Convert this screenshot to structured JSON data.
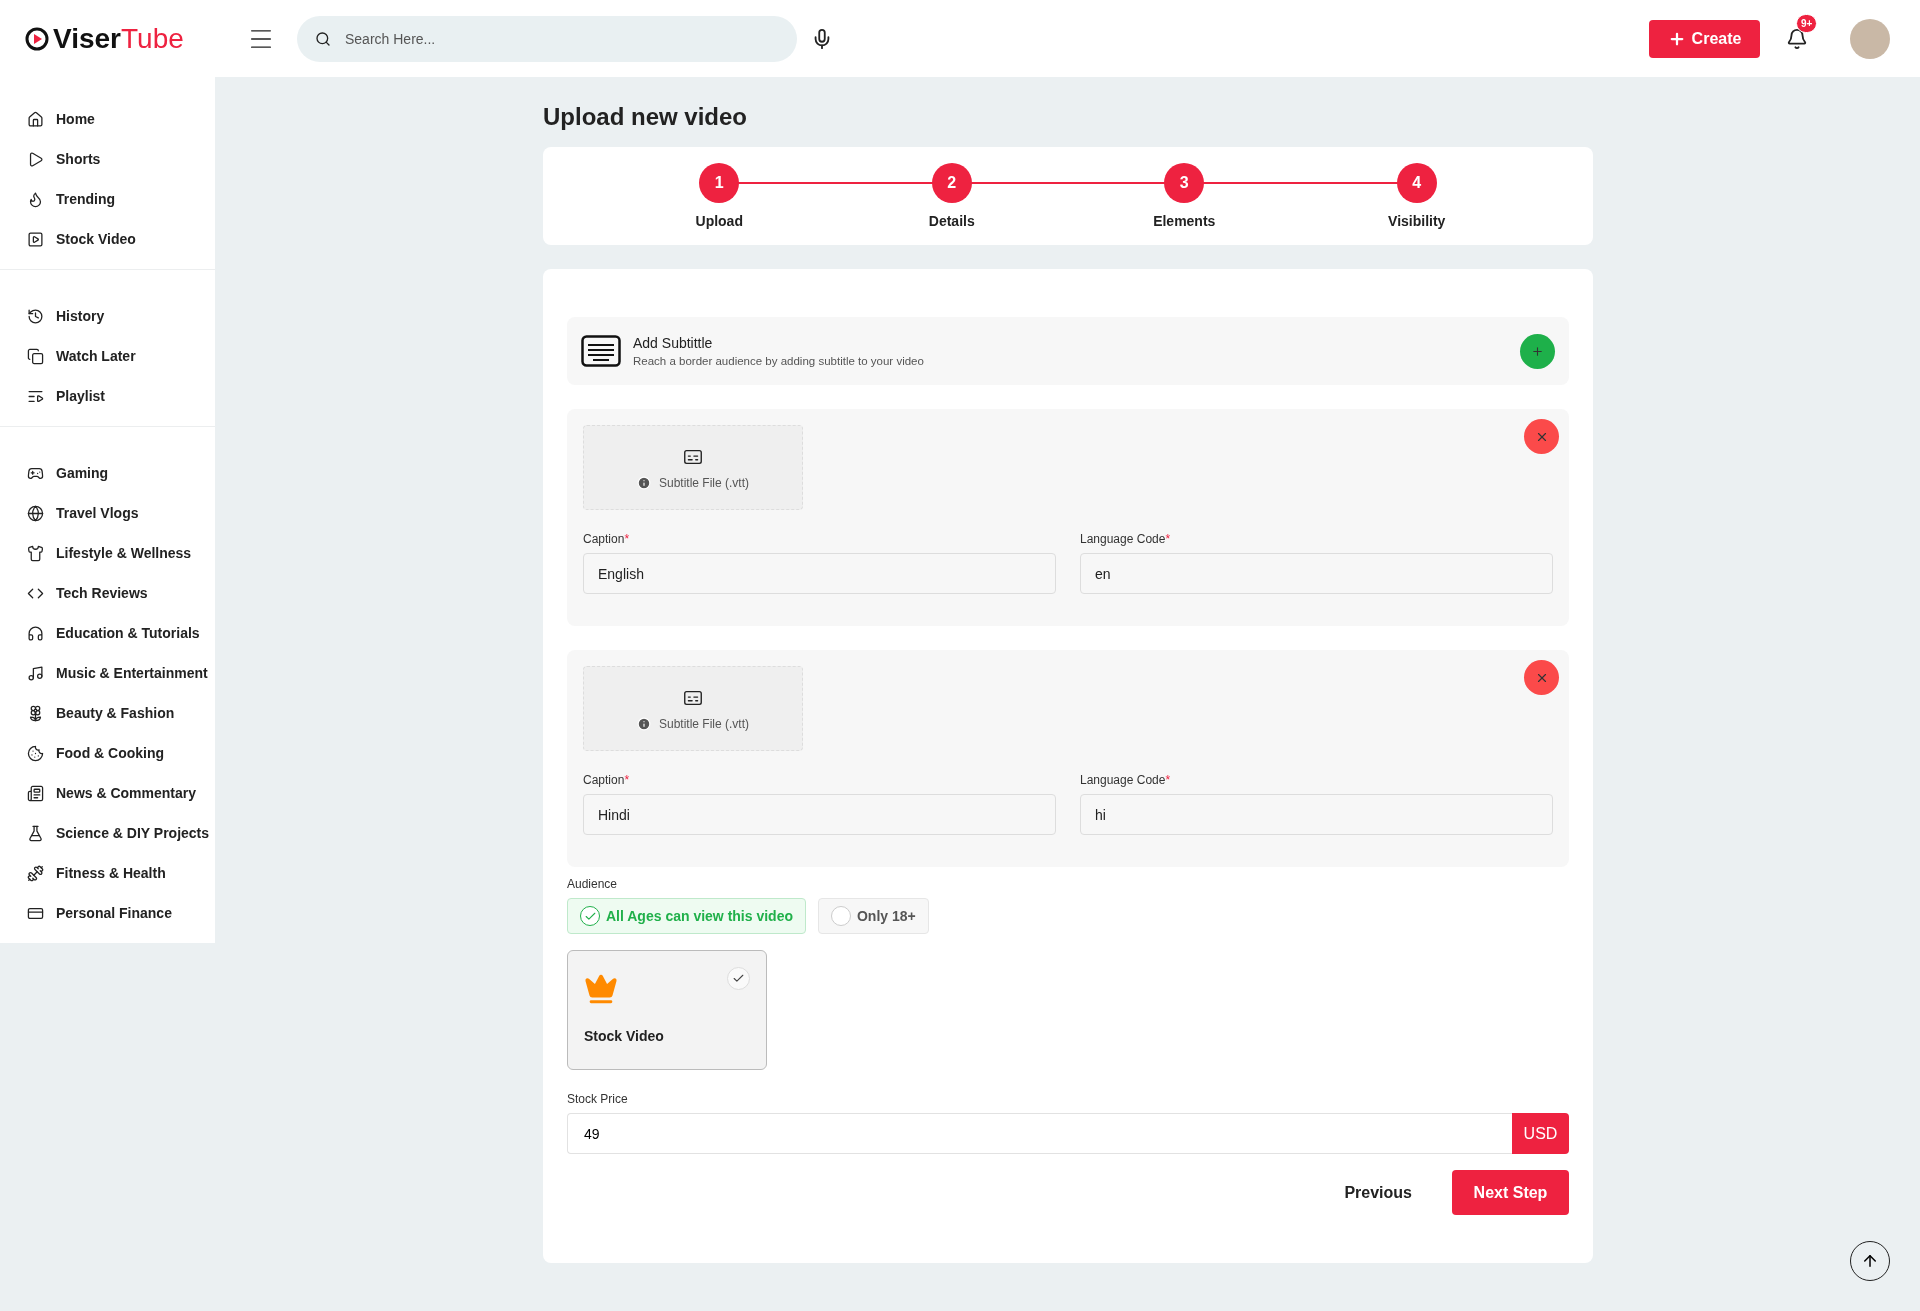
{
  "header": {
    "logo": {
      "part_1": "Viser",
      "part_2": "Tube"
    },
    "search": {
      "placeholder": "Search Here..."
    },
    "create_button": "Create",
    "notification_badge": "9+"
  },
  "sidebar": {
    "groups": [
      {
        "items": [
          {
            "label": "Home"
          },
          {
            "label": "Shorts"
          },
          {
            "label": "Trending"
          },
          {
            "label": "Stock Video"
          }
        ]
      },
      {
        "items": [
          {
            "label": "History"
          },
          {
            "label": "Watch Later"
          },
          {
            "label": "Playlist"
          }
        ]
      },
      {
        "items": [
          {
            "label": "Gaming"
          },
          {
            "label": "Travel Vlogs"
          },
          {
            "label": "Lifestyle & Wellness"
          },
          {
            "label": "Tech Reviews"
          },
          {
            "label": "Education & Tutorials"
          },
          {
            "label": "Music & Entertainment"
          },
          {
            "label": "Beauty & Fashion"
          },
          {
            "label": "Food & Cooking"
          },
          {
            "label": "News & Commentary"
          },
          {
            "label": "Science & DIY Projects"
          },
          {
            "label": "Fitness & Health"
          },
          {
            "label": "Personal Finance"
          }
        ]
      }
    ]
  },
  "page_title": "Upload new video",
  "steps": [
    {
      "number": "1",
      "label": "Upload",
      "done": true
    },
    {
      "number": "2",
      "label": "Details",
      "done": true
    },
    {
      "number": "3",
      "label": "Elements",
      "done": true
    },
    {
      "number": "4",
      "label": "Visibility",
      "done": true
    }
  ],
  "add_subtitle": {
    "title": "Add Subtittle",
    "description": "Reach a border audience by adding subtitle to your video"
  },
  "subtitles": [
    {
      "file_label": "Subtitle File (.vtt)",
      "caption_label": "Caption",
      "caption_required": "*",
      "caption": "English",
      "code_label": "Language Code",
      "code_required": "*",
      "code": "en"
    },
    {
      "file_label": "Subtitle File (.vtt)",
      "caption_label": "Caption",
      "caption_required": "*",
      "caption": "Hindi",
      "code_label": "Language Code",
      "code_required": "*",
      "code": "hi"
    }
  ],
  "audience": {
    "label": "Audience",
    "options": [
      {
        "label": "All Ages can view this video",
        "selected": true
      },
      {
        "label": "Only 18+",
        "selected": false
      }
    ]
  },
  "stock_video": {
    "label": "Stock Video",
    "checked": true
  },
  "stock_price": {
    "label": "Stock Price",
    "value": "49",
    "currency": "USD"
  },
  "buttons": {
    "previous": "Previous",
    "next": "Next Step"
  }
}
